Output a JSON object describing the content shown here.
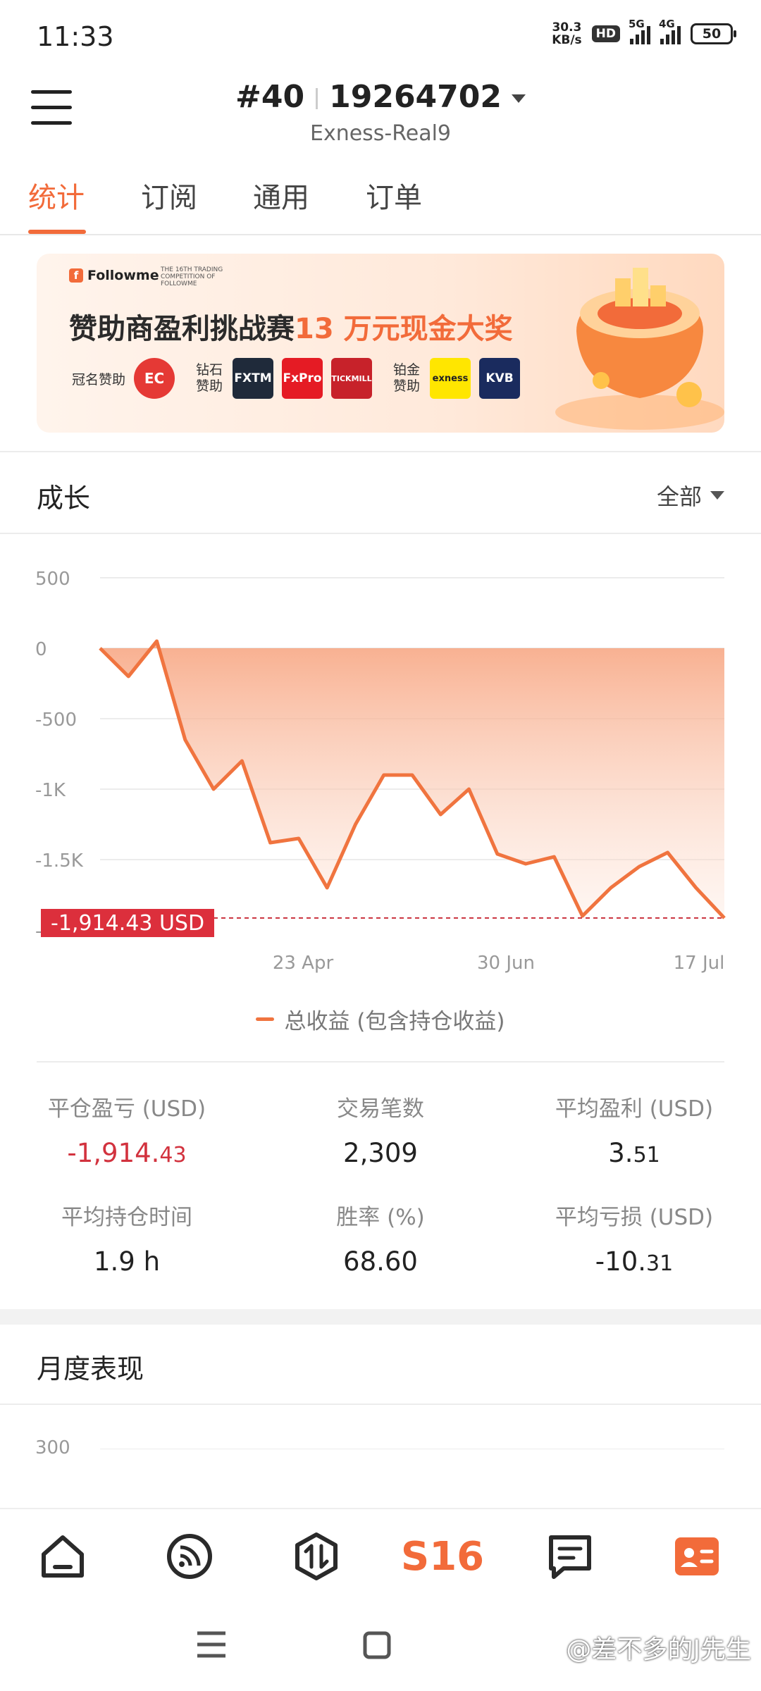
{
  "status_bar": {
    "time": "11:33",
    "net_speed_value": "30.3",
    "net_speed_unit": "KB/s",
    "hd_badge": "HD",
    "sim1_label": "5G",
    "sim2_label": "4G",
    "battery": "50"
  },
  "header": {
    "rank": "#40",
    "account_id": "19264702",
    "server": "Exness-Real9"
  },
  "tabs": [
    {
      "label": "统计",
      "active": true
    },
    {
      "label": "订阅",
      "active": false
    },
    {
      "label": "通用",
      "active": false
    },
    {
      "label": "订单",
      "active": false
    }
  ],
  "banner": {
    "brand": "Followme",
    "competition_line": "THE 16TH TRADING COMPETITION OF FOLLOWME",
    "title_prefix": "赞助商盈利挑战赛",
    "title_highlight": "13 万元现金大奖",
    "title_sponsor_label": "冠名赞助",
    "diamond_label": "钻石赞助",
    "platinum_label": "铂金赞助",
    "sponsors": [
      "EC",
      "FXTM",
      "FxPro",
      "TICKMILL",
      "exness",
      "KVB"
    ]
  },
  "growth": {
    "title": "成长",
    "filter": "全部",
    "current_value_label": "-1,914.43 USD",
    "legend": "总收益 (包含持仓收益)"
  },
  "chart_data": {
    "type": "area",
    "y_tick_labels": [
      "500",
      "0",
      "-500",
      "-1K",
      "-1.5K",
      "-2K"
    ],
    "ylim": [
      -2000,
      500
    ],
    "x_tick_labels": [
      "23 Apr",
      "30 Jun",
      "17 Jul"
    ],
    "series": [
      {
        "name": "总收益 (包含持仓收益)",
        "color": "#f0743f",
        "values": [
          0,
          -200,
          50,
          -650,
          -1000,
          -800,
          -1380,
          -1350,
          -1700,
          -1250,
          -900,
          -900,
          -1180,
          -1000,
          -1460,
          -1530,
          -1480,
          -1900,
          -1700,
          -1550,
          -1450,
          -1700,
          -1914.43
        ]
      }
    ],
    "reference_line": -1914.43,
    "grid": true
  },
  "stats": [
    {
      "label": "平仓盈亏 (USD)",
      "value_main": "-1,914.",
      "value_small": "43",
      "negative": true
    },
    {
      "label": "交易笔数",
      "value_main": "2,309",
      "value_small": "",
      "negative": false
    },
    {
      "label": "平均盈利 (USD)",
      "value_main": "3.",
      "value_small": "51",
      "negative": false
    },
    {
      "label": "平均持仓时间",
      "value_main": "1.9 h",
      "value_small": "",
      "negative": false
    },
    {
      "label": "胜率 (%)",
      "value_main": "68.60",
      "value_small": "",
      "negative": false
    },
    {
      "label": "平均亏损 (USD)",
      "value_main": "-10.",
      "value_small": "31",
      "negative": false
    }
  ],
  "monthly": {
    "title": "月度表现",
    "first_tick": "300"
  },
  "bottom_nav": {
    "items": [
      "home-icon",
      "feed-icon",
      "trade-icon",
      "s16-logo",
      "message-icon",
      "profile-icon"
    ],
    "s16_label": "S16"
  },
  "watermark": "@差不多的J先生"
}
